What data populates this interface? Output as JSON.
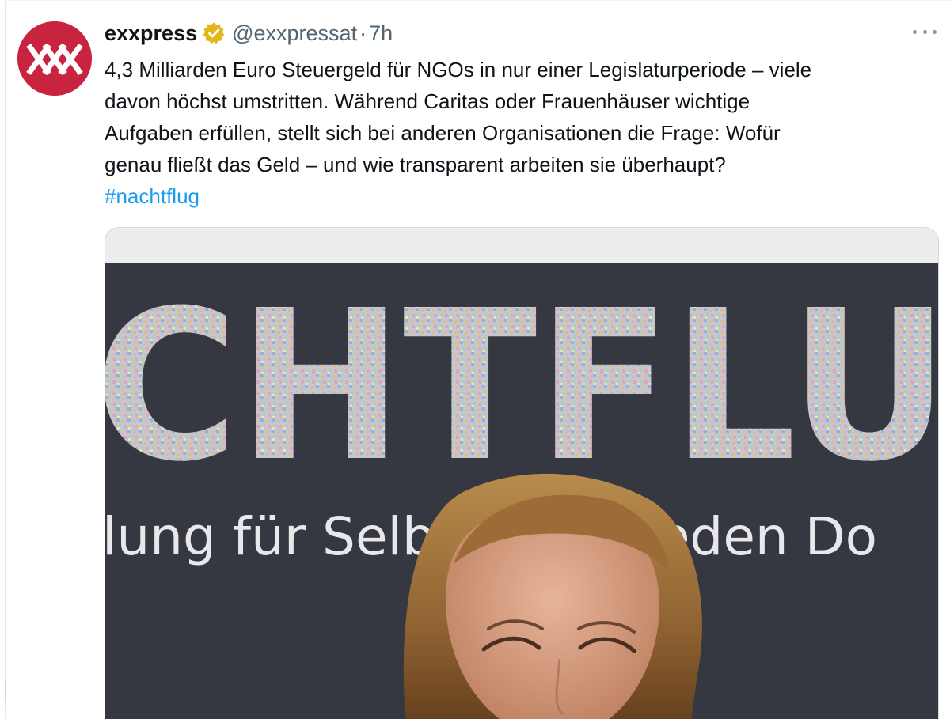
{
  "tweet": {
    "author": {
      "display_name": "exxpress",
      "handle": "@exxpressat",
      "avatar_icon": "exxpress-logo",
      "verified_icon": "verified-gold-badge"
    },
    "separator": "·",
    "time": "7h",
    "more_icon": "more-horizontal-icon",
    "text_lines": [
      "4,3 Milliarden Euro Steuergeld für NGOs in nur einer Legislaturperiode – viele",
      "davon höchst umstritten. Während Caritas oder Frauenhäuser wichtige",
      "Aufgaben erfüllen, stellt sich bei anderen Organisationen die Frage: Wofür",
      "genau fließt das Geld – und wie transparent arbeiten sie überhaupt?"
    ],
    "hashtag": "#nachtflug",
    "media": {
      "backdrop_big_text": "CHTFLU",
      "backdrop_sub_text": "lung für Selber       r jeden Do"
    }
  },
  "colors": {
    "brand_red": "#c9243f",
    "link_blue": "#1d9bf0",
    "text_primary": "#0f1419",
    "text_secondary": "#536471",
    "badge_gold": "#e2b719"
  }
}
